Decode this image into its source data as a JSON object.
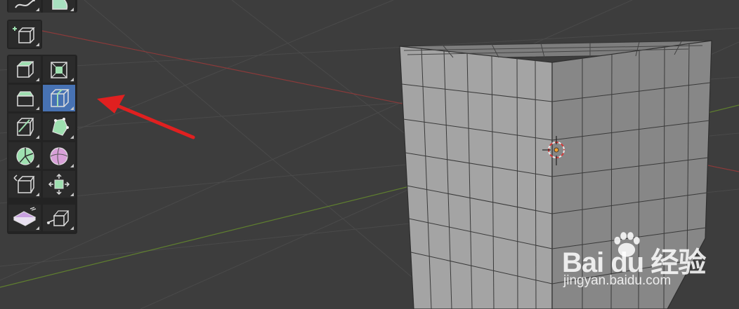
{
  "app": "Blender 3D Viewport",
  "toolbar": {
    "tools": [
      {
        "name": "draw-annotate",
        "icon": "annotate-curve-icon"
      },
      {
        "name": "measure",
        "icon": "measure-icon"
      },
      {
        "name": "add-cube",
        "icon": "add-cube-icon"
      },
      {
        "name": "extrude-region",
        "icon": "extrude-region-icon"
      },
      {
        "name": "inset-faces",
        "icon": "inset-faces-icon"
      },
      {
        "name": "bevel",
        "icon": "bevel-icon"
      },
      {
        "name": "loop-cut",
        "icon": "loop-cut-icon",
        "active": true
      },
      {
        "name": "knife",
        "icon": "knife-icon"
      },
      {
        "name": "poly-build",
        "icon": "poly-build-icon"
      },
      {
        "name": "spin",
        "icon": "spin-icon"
      },
      {
        "name": "smooth",
        "icon": "smooth-icon"
      },
      {
        "name": "edge-slide",
        "icon": "edge-slide-icon"
      },
      {
        "name": "shrink-fatten",
        "icon": "shrink-fatten-icon"
      },
      {
        "name": "shear",
        "icon": "shear-icon"
      },
      {
        "name": "rip-region",
        "icon": "rip-region-icon"
      }
    ],
    "active_color": "#4772b3"
  },
  "annotation": {
    "arrow_color": "#e02020",
    "points_to": "loop-cut"
  },
  "scene": {
    "object": "cube",
    "grid_subdivisions": 7,
    "x_axis_color": "#8a3a3a",
    "y_axis_color": "#5a7a2a"
  },
  "watermark": {
    "brand": "Bai du 经验",
    "url": "jingyan.baidu.com"
  }
}
